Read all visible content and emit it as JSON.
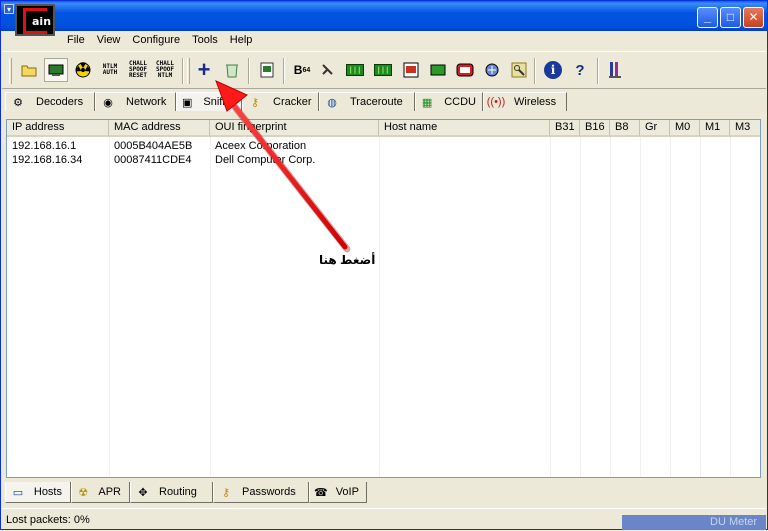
{
  "app": {
    "logo_text": "ain",
    "title_buttons": {
      "minimize": "_",
      "maximize": "□",
      "close": "✕"
    }
  },
  "menu": [
    "File",
    "View",
    "Configure",
    "Tools",
    "Help"
  ],
  "toolbar": {
    "b64_label": "B",
    "b64_sub": "64",
    "ntlm_auth": "NTLM AUTH",
    "chall_spoof_reset": "CHALL SPOOF RESET",
    "chall_spoof_ntlm": "CHALL SPOOF NTLM",
    "add_icon": "+",
    "info_icon": "i",
    "help_icon": "?"
  },
  "tabs_top": [
    {
      "label": "Decoders",
      "icon": "decoder-icon"
    },
    {
      "label": "Network",
      "icon": "network-icon"
    },
    {
      "label": "Sniffer",
      "icon": "sniffer-icon"
    },
    {
      "label": "Cracker",
      "icon": "key-icon"
    },
    {
      "label": "Traceroute",
      "icon": "globe-icon"
    },
    {
      "label": "CCDU",
      "icon": "ccdu-icon"
    },
    {
      "label": "Wireless",
      "icon": "antenna-icon"
    }
  ],
  "table": {
    "columns": [
      "IP address",
      "MAC address",
      "OUI fingerprint",
      "Host name",
      "B31",
      "B16",
      "B8",
      "Gr",
      "M0",
      "M1",
      "M3"
    ],
    "rows": [
      [
        "192.168.16.1",
        "0005B404AE5B",
        "Aceex Corporation",
        "",
        "",
        "",
        "",
        "",
        "",
        "",
        ""
      ],
      [
        "192.168.16.34",
        "00087411CDE4",
        "Dell Computer Corp.",
        "",
        "",
        "",
        "",
        "",
        "",
        "",
        ""
      ]
    ]
  },
  "annotation": "أضغط هنا",
  "tabs_bottom": [
    {
      "label": "Hosts",
      "icon": "computer-icon"
    },
    {
      "label": "APR",
      "icon": "radiation-icon"
    },
    {
      "label": "Routing",
      "icon": "move-arrows-icon"
    },
    {
      "label": "Passwords",
      "icon": "keys-icon"
    },
    {
      "label": "VoIP",
      "icon": "phone-icon"
    }
  ],
  "status": {
    "lost_packets": "Lost packets:  0%",
    "du_meter": "DU Meter"
  },
  "colors": {
    "titlebar": "#0054e3",
    "accent_red": "#e01010",
    "annotation_arrow": "#ff1a1a"
  }
}
